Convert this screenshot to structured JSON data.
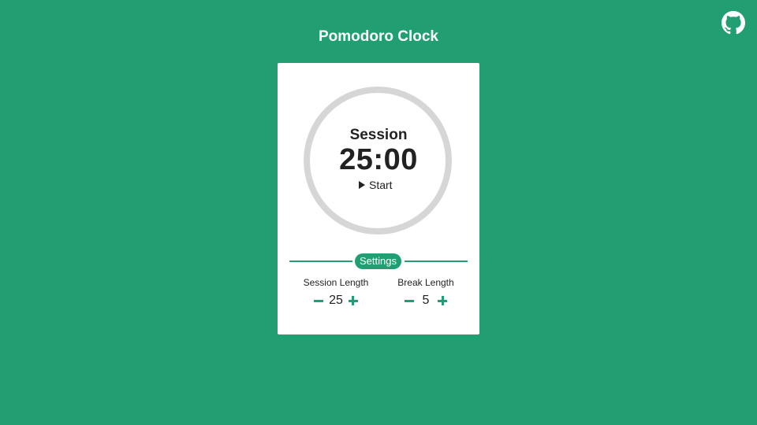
{
  "header": {
    "title": "Pomodoro Clock",
    "github_icon": "github-icon"
  },
  "timer": {
    "mode": "Session",
    "time": "25:00",
    "start_label": "Start",
    "ring_color": "#d6d6d6"
  },
  "settings": {
    "title": "Settings",
    "session": {
      "label": "Session Length",
      "value": "25"
    },
    "break": {
      "label": "Break Length",
      "value": "5"
    }
  },
  "colors": {
    "background": "#229f72",
    "card": "#ffffff",
    "accent": "#229f72",
    "text": "#222222"
  }
}
